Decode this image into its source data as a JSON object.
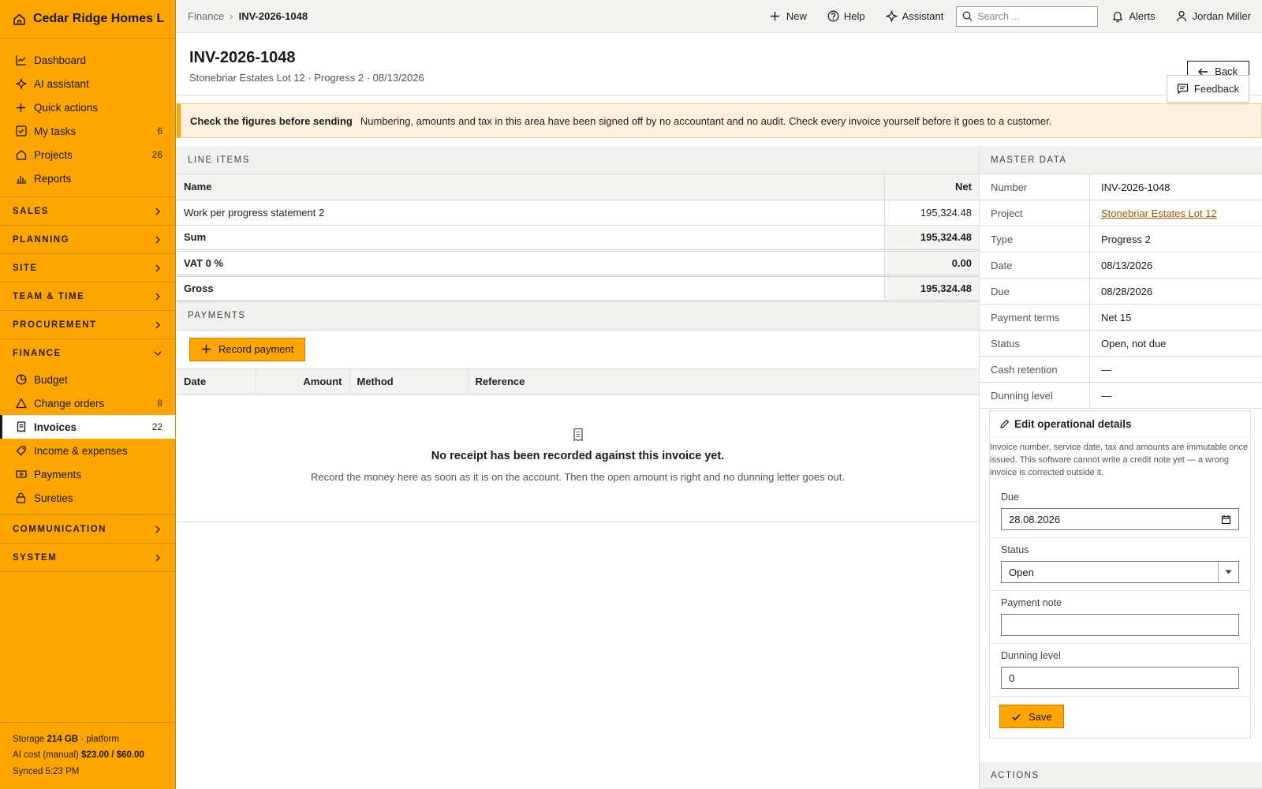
{
  "app": {
    "name": "Cedar Ridge Homes L..."
  },
  "nav_top": [
    {
      "label": "Dashboard",
      "count": ""
    },
    {
      "label": "AI assistant",
      "count": ""
    },
    {
      "label": "Quick actions",
      "count": ""
    },
    {
      "label": "My tasks",
      "count": "6"
    },
    {
      "label": "Projects",
      "count": "26"
    },
    {
      "label": "Reports",
      "count": ""
    }
  ],
  "sections": {
    "sales": "SALES",
    "planning": "PLANNING",
    "site": "SITE",
    "team_time": "TEAM & TIME",
    "procurement": "PROCUREMENT",
    "finance": "FINANCE",
    "communication": "COMMUNICATION",
    "system": "SYSTEM"
  },
  "finance_items": [
    {
      "label": "Budget",
      "count": ""
    },
    {
      "label": "Change orders",
      "count": "8"
    },
    {
      "label": "Invoices",
      "count": "22"
    },
    {
      "label": "Income & expenses",
      "count": ""
    },
    {
      "label": "Payments",
      "count": ""
    },
    {
      "label": "Sureties",
      "count": ""
    }
  ],
  "footer": {
    "storage_label": "Storage",
    "storage_value": "214 GB",
    "storage_suffix": "· platform",
    "ai_label": "AI cost (manual)",
    "ai_value": "$23.00 / $60.00",
    "synced": "Synced 5:23 PM"
  },
  "topbar": {
    "crumb_parent": "Finance",
    "crumb_sep": "›",
    "crumb_current": "INV-2026-1048",
    "new": "New",
    "help": "Help",
    "assistant": "Assistant",
    "search_placeholder": "Search ...",
    "alerts": "Alerts",
    "user": "Jordan Miller"
  },
  "header": {
    "title": "INV-2026-1048",
    "subtitle": "Stonebriar Estates Lot 12 · Progress 2 · 08/13/2026",
    "back": "Back",
    "feedback": "Feedback"
  },
  "warning": {
    "title": "Check the figures before sending",
    "text": "Numbering, amounts and tax in this area have been signed off by no accountant and no audit. Check every invoice yourself before it goes to a customer."
  },
  "line_items": {
    "heading": "LINE ITEMS",
    "col_name": "Name",
    "col_net": "Net",
    "rows": [
      {
        "name": "Work per progress statement 2",
        "net": "195,324.48"
      }
    ],
    "sum_label": "Sum",
    "sum_value": "195,324.48",
    "vat_label": "VAT 0 %",
    "vat_value": "0.00",
    "gross_label": "Gross",
    "gross_value": "195,324.48"
  },
  "payments": {
    "heading": "PAYMENTS",
    "record_button": "Record payment",
    "cols": {
      "date": "Date",
      "amount": "Amount",
      "method": "Method",
      "reference": "Reference"
    },
    "empty_title": "No receipt has been recorded against this invoice yet.",
    "empty_text": "Record the money here as soon as it is on the account. Then the open amount is right and no dunning letter goes out."
  },
  "master": {
    "heading": "MASTER DATA",
    "rows": [
      {
        "key": "Number",
        "value": "INV-2026-1048"
      },
      {
        "key": "Project",
        "value": "Stonebriar Estates Lot 12"
      },
      {
        "key": "Type",
        "value": "Progress 2"
      },
      {
        "key": "Date",
        "value": "08/13/2026"
      },
      {
        "key": "Due",
        "value": "08/28/2026"
      },
      {
        "key": "Payment terms",
        "value": "Net 15"
      },
      {
        "key": "Status",
        "value": "Open, not due"
      },
      {
        "key": "Cash retention",
        "value": "—"
      },
      {
        "key": "Dunning level",
        "value": "—"
      }
    ]
  },
  "edit": {
    "title": "Edit operational details",
    "note": "Invoice number, service date, tax and amounts are immutable once issued. This software cannot write a credit note yet — a wrong invoice is corrected outside it.",
    "due_label": "Due",
    "due_value": "28.08.2026",
    "status_label": "Status",
    "status_value": "Open",
    "note_label": "Payment note",
    "note_value": "",
    "dunning_label": "Dunning level",
    "dunning_value": "0",
    "save": "Save"
  },
  "actions": {
    "heading": "ACTIONS"
  },
  "colors": {
    "accent": "#ffa500",
    "link": "#9a5a00",
    "warning_bg": "#fdf1de"
  }
}
